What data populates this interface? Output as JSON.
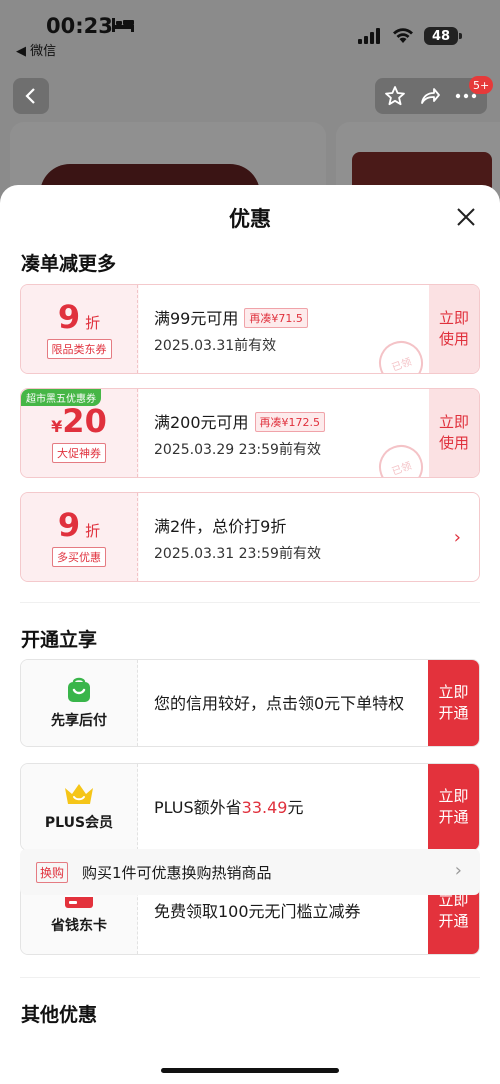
{
  "status_bar": {
    "time": "00:23",
    "back_app": "◀ 微信",
    "battery": "48"
  },
  "background": {
    "notification_badge": "5+"
  },
  "sheet": {
    "title": "优惠"
  },
  "section_stack": {
    "title": "凑单减更多"
  },
  "coupons": [
    {
      "value": "9",
      "unit": "折",
      "tag": "限品类东券",
      "condition": "满99元可用",
      "extra": "再凑¥71.5",
      "expire": "2025.03.31前有效",
      "action": "立即\n使用",
      "stamp": "已领"
    },
    {
      "corner": "超市黑五优惠券",
      "currency": "¥",
      "value": "20",
      "tag": "大促神券",
      "condition": "满200元可用",
      "extra": "再凑¥172.5",
      "expire": "2025.03.29 23:59前有效",
      "action": "立即\n使用",
      "stamp": "已领"
    },
    {
      "value": "9",
      "unit": "折",
      "tag": "多买优惠",
      "condition": "满2件，总价打9折",
      "expire": "2025.03.31 23:59前有效"
    }
  ],
  "section_open": {
    "title": "开通立享"
  },
  "services": [
    {
      "icon": "bag-icon",
      "label": "先享后付",
      "desc": "您的信用较好，点击领0元下单特权",
      "action": "立即\n开通"
    },
    {
      "icon": "crown-icon",
      "label": "PLUS会员",
      "desc_prefix": "PLUS额外省",
      "desc_amount": "33.49",
      "desc_suffix": "元",
      "action": "立即\n开通"
    },
    {
      "icon": "card-icon",
      "label": "省钱东卡",
      "desc": "免费领取100元无门槛立减券",
      "action": "立即\n开通"
    }
  ],
  "section_other": {
    "title": "其他优惠"
  },
  "other": {
    "tag": "换购",
    "text": "购买1件可优惠换购热销商品"
  },
  "colors": {
    "accent": "#e0313d",
    "button_red": "#e3323c",
    "coupon_bg": "#fff5f6",
    "green": "#46b646"
  }
}
